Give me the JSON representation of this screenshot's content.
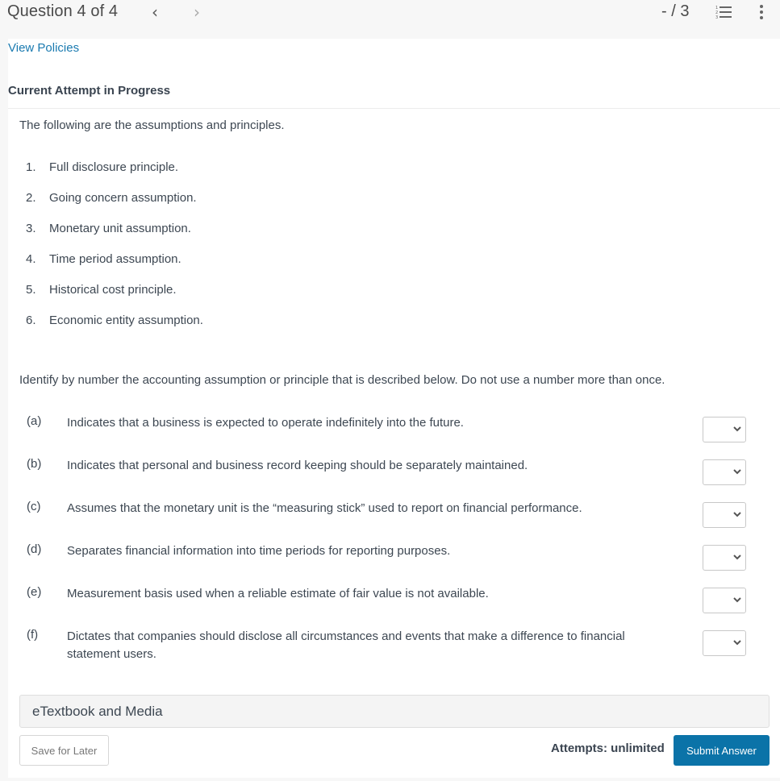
{
  "header": {
    "question_title": "Question 4 of 4",
    "prev_icon": "chevron-left-icon",
    "next_icon": "chevron-right-icon",
    "score": "- / 3",
    "list_icon": "numbered-list-icon",
    "more_icon": "more-vertical-icon"
  },
  "links": {
    "view_policies": "View Policies"
  },
  "attempt": {
    "heading": "Current Attempt in Progress"
  },
  "question": {
    "intro": "The following are the assumptions and principles.",
    "assumptions": [
      {
        "num": "1.",
        "text": "Full disclosure principle."
      },
      {
        "num": "2.",
        "text": "Going concern assumption."
      },
      {
        "num": "3.",
        "text": "Monetary unit assumption."
      },
      {
        "num": "4.",
        "text": "Time period assumption."
      },
      {
        "num": "5.",
        "text": "Historical cost principle."
      },
      {
        "num": "6.",
        "text": "Economic entity assumption."
      }
    ],
    "instructions": "Identify by number the accounting assumption or principle that is described below. Do not use a number more than once.",
    "items": [
      {
        "label": "(a)",
        "text": "Indicates that a business is expected to operate indefinitely into the future.",
        "selected": ""
      },
      {
        "label": "(b)",
        "text": "Indicates that personal and business record keeping should be separately maintained.",
        "selected": ""
      },
      {
        "label": "(c)",
        "text": "Assumes that the monetary unit is the “measuring stick” used to report on financial performance.",
        "selected": ""
      },
      {
        "label": "(d)",
        "text": "Separates financial information into time periods for reporting purposes.",
        "selected": ""
      },
      {
        "label": "(e)",
        "text": "Measurement basis used when a reliable estimate of fair value is not available.",
        "selected": ""
      },
      {
        "label": "(f)",
        "text": "Dictates that companies should disclose all circumstances and events that make a difference to financial statement users.",
        "selected": ""
      }
    ]
  },
  "footer": {
    "etextbook_label": "eTextbook and Media",
    "save_label": "Save for Later",
    "attempts_label": "Attempts: unlimited",
    "submit_label": "Submit Answer"
  },
  "colors": {
    "link": "#1a7ab0",
    "submit_bg": "#0b73a8",
    "page_bg": "#f7f7f7"
  }
}
